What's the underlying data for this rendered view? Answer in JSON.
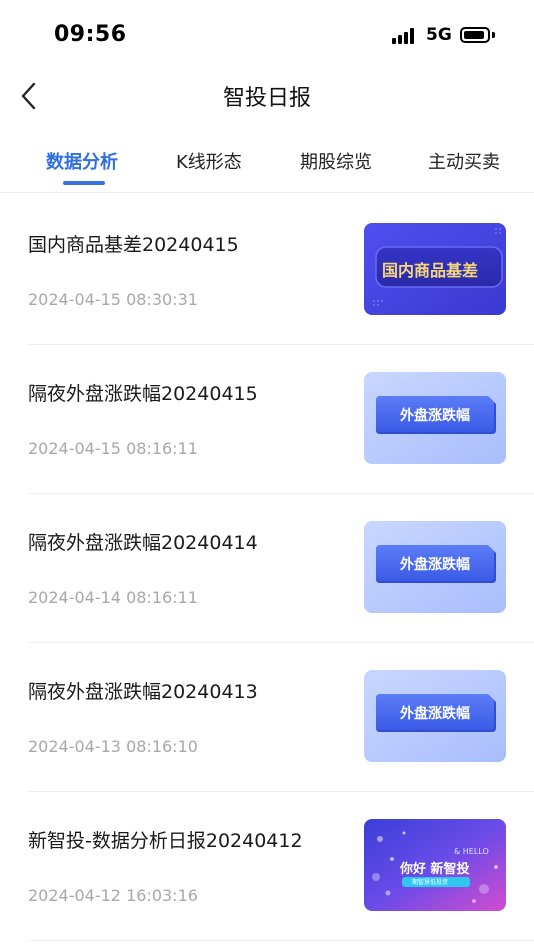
{
  "status_bar": {
    "time": "09:56",
    "network": "5G"
  },
  "header": {
    "title": "智投日报"
  },
  "tabs": [
    {
      "label": "数据分析",
      "active": true
    },
    {
      "label": "K线形态",
      "active": false
    },
    {
      "label": "期股综览",
      "active": false
    },
    {
      "label": "主动买卖",
      "active": false
    }
  ],
  "articles": [
    {
      "title": "国内商品基差20240415",
      "time": "2024-04-15 08:30:31",
      "thumb_text": "国内商品基差",
      "thumb_style": "dark-blue"
    },
    {
      "title": "隔夜外盘涨跌幅20240415",
      "time": "2024-04-15 08:16:11",
      "thumb_text": "外盘涨跌幅",
      "thumb_style": "light-blue"
    },
    {
      "title": "隔夜外盘涨跌幅20240414",
      "time": "2024-04-14 08:16:11",
      "thumb_text": "外盘涨跌幅",
      "thumb_style": "light-blue"
    },
    {
      "title": "隔夜外盘涨跌幅20240413",
      "time": "2024-04-13 08:16:10",
      "thumb_text": "外盘涨跌幅",
      "thumb_style": "light-blue"
    },
    {
      "title": "新智投-数据分析日报20240412",
      "time": "2024-04-12 16:03:16",
      "thumb_text": "你好 新智投",
      "thumb_hello": "& HELLO",
      "thumb_sub": "期智慧低投资",
      "thumb_style": "gradient"
    }
  ],
  "colors": {
    "accent": "#2f6fe0",
    "muted_text": "#a8a8a8",
    "divider": "#efefef"
  }
}
